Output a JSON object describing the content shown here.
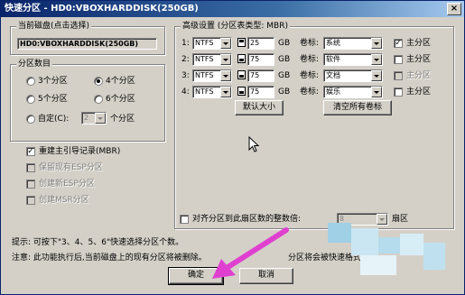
{
  "window": {
    "title": "快速分区 - HD0:VBOXHARDDISK(250GB)",
    "close_glyph": "×"
  },
  "disk_group": {
    "legend": "当前磁盘(点击选择)",
    "selected": "HD0:VBOXHARDDISK(250GB)"
  },
  "count_group": {
    "legend": "分区数目",
    "options": [
      "3个分区",
      "4个分区",
      "5个分区",
      "6个分区"
    ],
    "selected": "4个分区",
    "custom_label": "自定(C):",
    "custom_value": "2",
    "custom_suffix": "个分区"
  },
  "options": {
    "rebuild_mbr": {
      "label": "重建主引导记录(MBR)",
      "checked": true
    },
    "keep_esp": {
      "label": "保留现有ESP分区"
    },
    "create_esp": {
      "label": "创建新ESP分区"
    },
    "create_msr": {
      "label": "创建MSR分区"
    }
  },
  "advanced": {
    "legend": "高级设置 (分区表类型: MBR)",
    "size_unit": "GB",
    "volume_label_caption": "卷标:",
    "primary_label": "主分区",
    "rows": [
      {
        "index": "1:",
        "fs": "NTFS",
        "size": "25",
        "label": "系统",
        "primary": true,
        "primary_enabled": true
      },
      {
        "index": "2:",
        "fs": "NTFS",
        "size": "75",
        "label": "软件",
        "primary": false,
        "primary_enabled": true
      },
      {
        "index": "3:",
        "fs": "NTFS",
        "size": "75",
        "label": "文档",
        "primary": false,
        "primary_enabled": false
      },
      {
        "index": "4:",
        "fs": "NTFS",
        "size": "75",
        "label": "娱乐",
        "primary": false,
        "primary_enabled": true
      }
    ],
    "default_size_button": "默认大小",
    "clear_labels_button": "清空所有卷标",
    "align_label": "对齐分区到此扇区数的整数倍:",
    "align_value": "8",
    "align_unit": "扇区"
  },
  "footer": {
    "tip": "提示: 可按下\"3、4、5、6\"快速选择分区个数。",
    "warning_left": "注意: 此功能执行后,当前磁盘上的现有分区将被删除。",
    "warning_right": "分区将会被快速格式化。"
  },
  "buttons": {
    "ok": "确定",
    "cancel": "取消"
  },
  "colors": {
    "annotation_arrow": "#e040d0",
    "title_bar": "#0a246a"
  }
}
